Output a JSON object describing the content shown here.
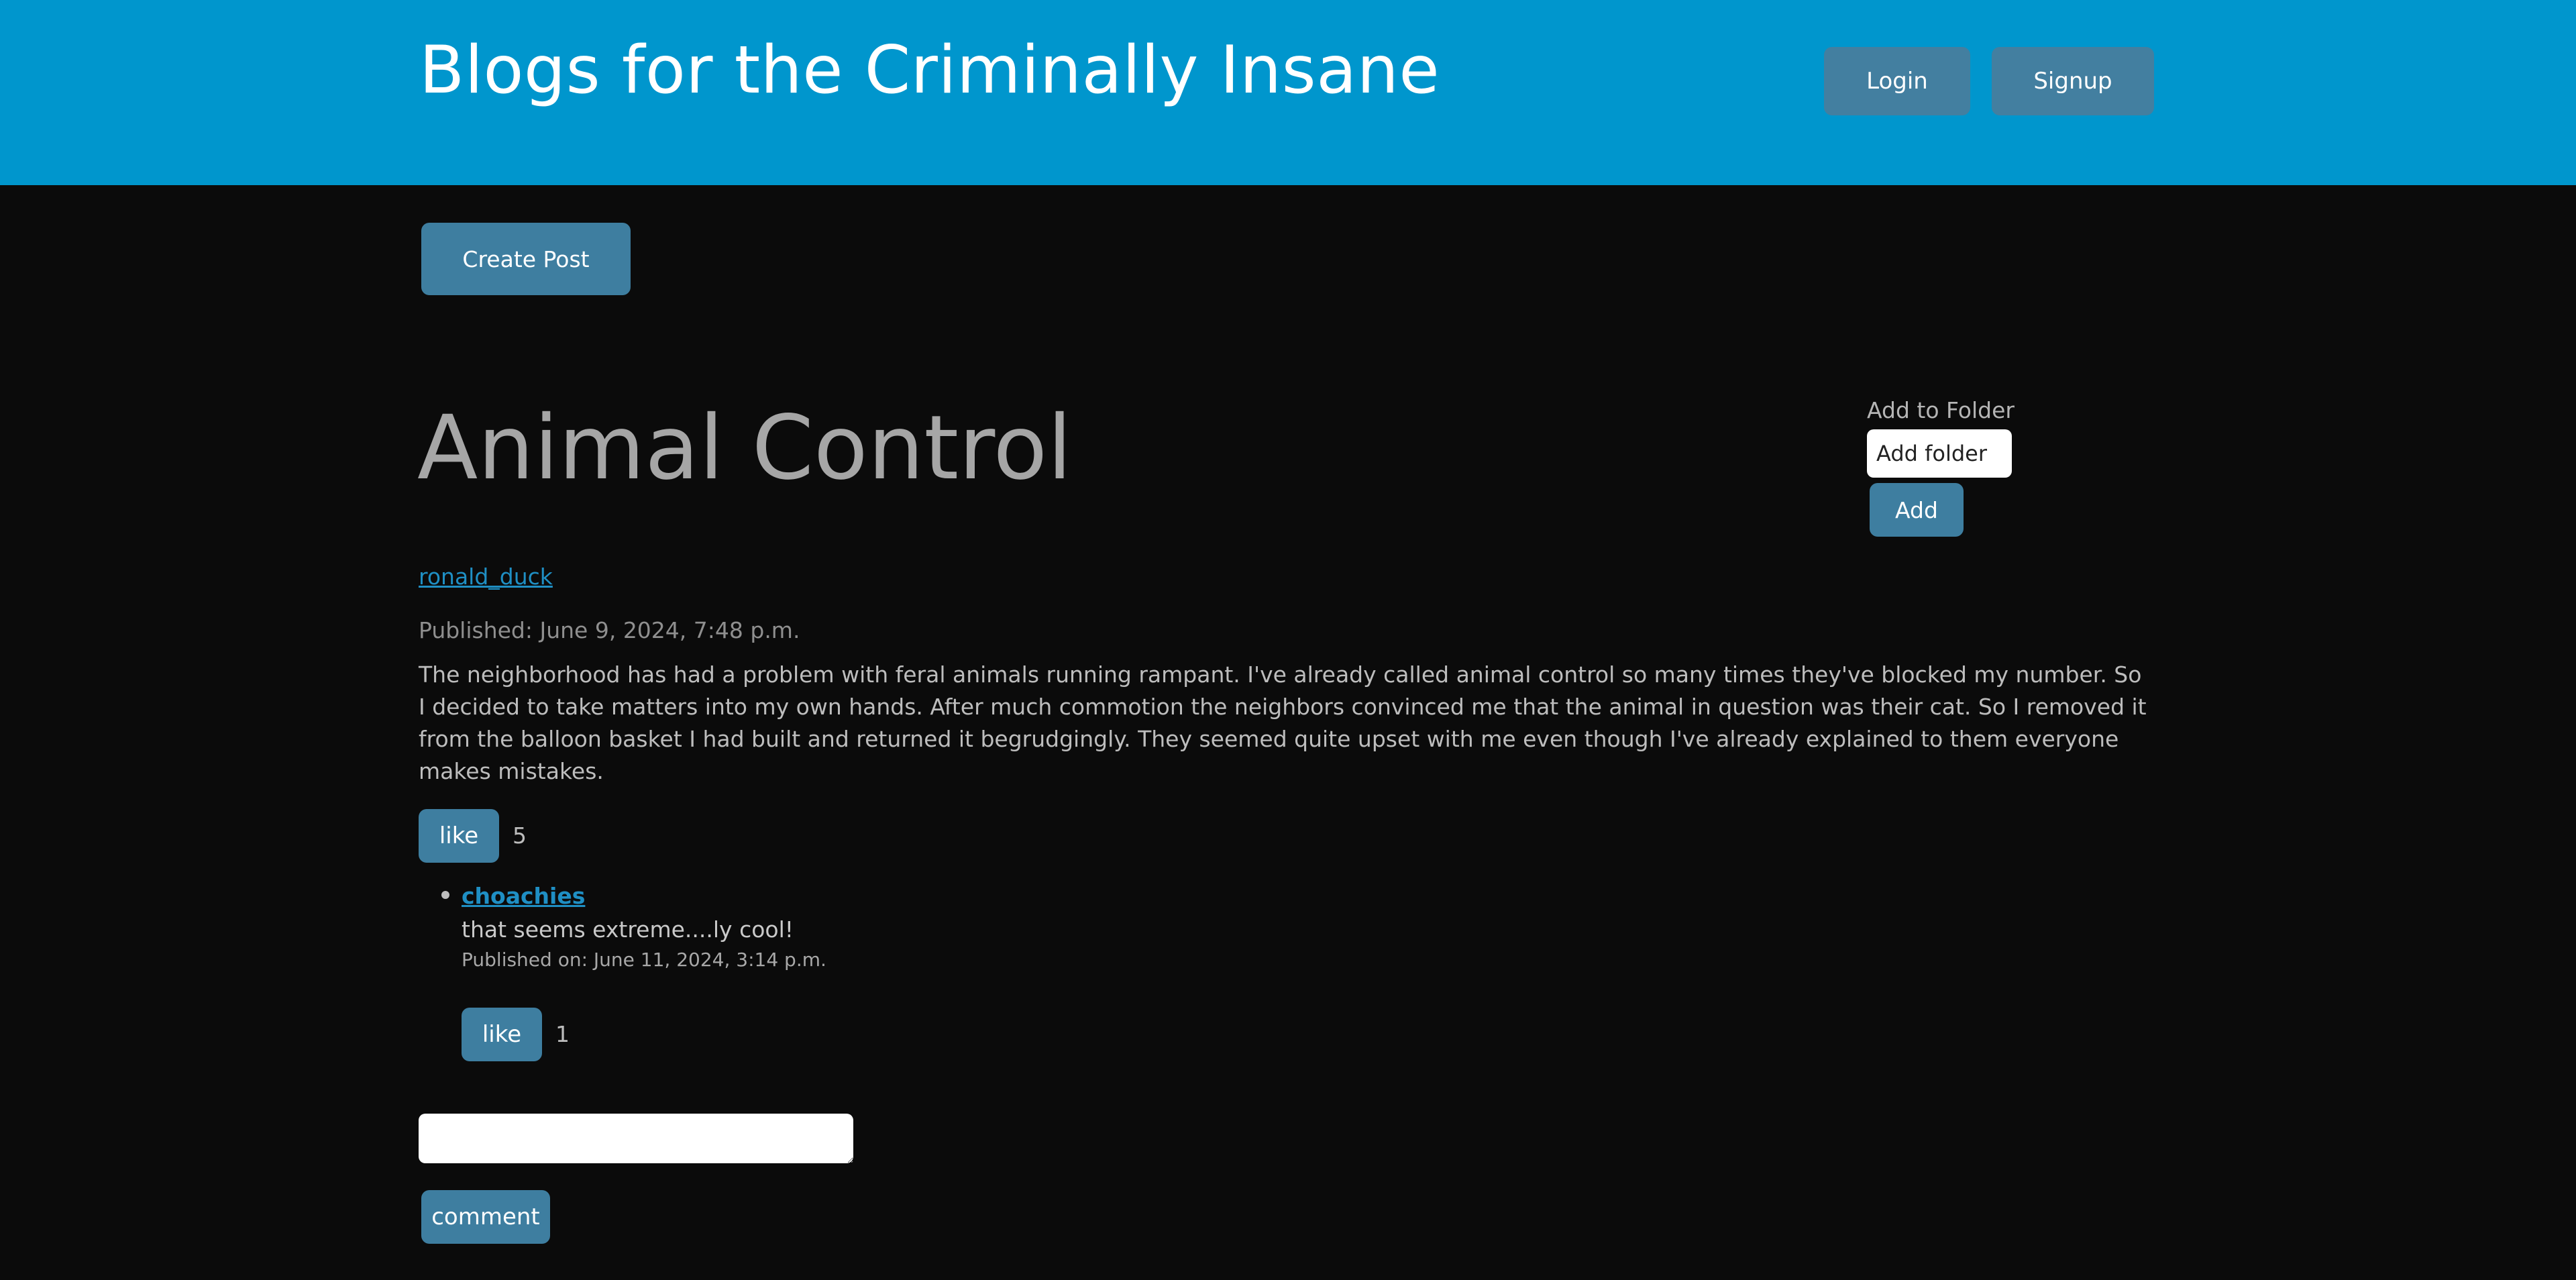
{
  "header": {
    "site_title": "Blogs for the Criminally Insane",
    "login_label": "Login",
    "signup_label": "Signup",
    "background_color": "#0096cd"
  },
  "toolbar": {
    "create_post_label": "Create Post"
  },
  "post": {
    "title": "Animal Control",
    "author": "ronald_duck",
    "published": "Published: June 9, 2024, 7:48 p.m.",
    "body": "The neighborhood has had a problem with feral animals running rampant. I've already called animal control so many times they've blocked my number. So I decided to take matters into my own hands. After much commotion the neighbors convinced me that the animal in question was their cat. So I removed it from the balloon basket I had built and returned it begrudgingly. They seemed quite upset with me even though I've already explained to them everyone makes mistakes.",
    "like_label": "like",
    "like_count": "5"
  },
  "folder": {
    "label": "Add to Folder",
    "input_placeholder": "Add folder",
    "add_label": "Add"
  },
  "comments": [
    {
      "author": "choachies",
      "text": "that seems extreme....ly cool!",
      "published": "Published on: June 11, 2024, 3:14 p.m.",
      "like_label": "like",
      "like_count": "1"
    }
  ],
  "comment_form": {
    "value": "",
    "submit_label": "comment"
  },
  "colors": {
    "page_background": "#0b0b0b",
    "button": "#3e7ea0",
    "link": "#1f8fc4"
  }
}
